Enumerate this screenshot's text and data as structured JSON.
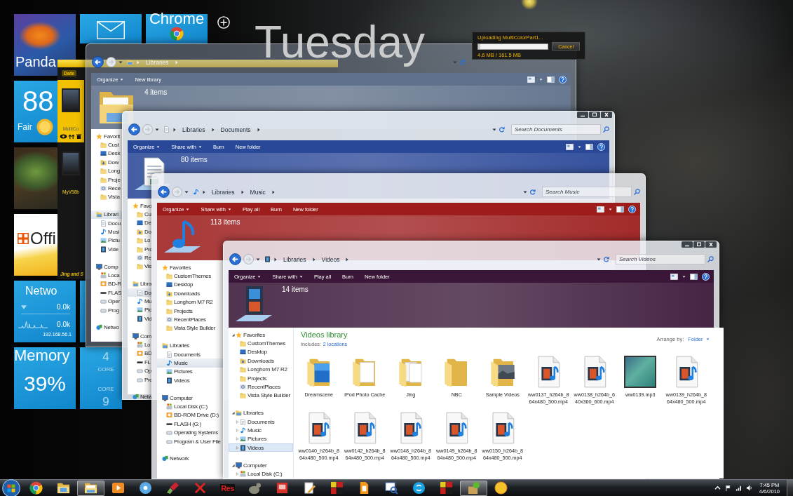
{
  "tiles": [
    {
      "kind": "photo",
      "label": "Panda"
    },
    {
      "kind": "mail"
    },
    {
      "kind": "browser",
      "label": "Chrome"
    },
    {
      "kind": "weather",
      "temperature": "88",
      "condition": "Fair"
    },
    {
      "kind": "photo"
    },
    {
      "kind": "office",
      "label": "Offi"
    },
    {
      "kind": "network",
      "label": "Netwo",
      "download": "0.0k",
      "upload": "0.0k",
      "address": "192.168.56.1"
    },
    {
      "kind": "blank"
    },
    {
      "kind": "memory",
      "label": "Memory",
      "reading": "39%"
    },
    {
      "kind": "cpu",
      "cores": [
        {
          "value": "4",
          "label": "CORE"
        },
        {
          "label": "CORE",
          "value": "9"
        }
      ]
    }
  ],
  "day_label": "Tuesday",
  "upload_dialog": {
    "title": "Uploading MultiColorPart1...",
    "level": 0.03,
    "progress": "4.6 MB / 161.5 MB",
    "button": "Cancel"
  },
  "capture_window": {
    "tab": "Date",
    "items": [
      {
        "label": "MultiCo",
        "selected": true
      },
      {
        "label": "MyV58b",
        "selected": false
      }
    ],
    "footer": "Jing and S"
  },
  "windows": [
    {
      "kind": "libraries",
      "color": "#5f708a",
      "caption_buttons": false,
      "breadcrumb": [
        "Libraries"
      ],
      "toolbar": [
        {
          "label": "Organize",
          "menu": true
        },
        {
          "label": "New library",
          "menu": false
        }
      ],
      "item_count": "4 items",
      "nav": [
        {
          "kind": "favorites",
          "label": "Favorit",
          "selected": false,
          "children": [
            {
              "kind": "folder",
              "label": "Cust",
              "selected": false
            },
            {
              "kind": "desktop",
              "label": "Desk",
              "selected": false
            },
            {
              "kind": "downloads",
              "label": "Dow",
              "selected": false
            },
            {
              "kind": "folder",
              "label": "Long",
              "selected": false
            },
            {
              "kind": "folder",
              "label": "Proje",
              "selected": false
            },
            {
              "kind": "recent",
              "label": "Rece",
              "selected": false
            },
            {
              "kind": "folder",
              "label": "Vista",
              "selected": false
            }
          ]
        },
        {
          "kind": "libraries",
          "label": "Librari",
          "selected": true,
          "children": [
            {
              "kind": "documents",
              "label": "Docu",
              "selected": false
            },
            {
              "kind": "music",
              "label": "Musi",
              "selected": false
            },
            {
              "kind": "pictures",
              "label": "Pictu",
              "selected": false
            },
            {
              "kind": "videos",
              "label": "Vide",
              "selected": false
            }
          ]
        },
        {
          "kind": "computer",
          "label": "Comp",
          "selected": false,
          "children": [
            {
              "kind": "disk",
              "label": "Loca",
              "selected": false
            },
            {
              "kind": "optical",
              "label": "BD-R",
              "selected": false
            },
            {
              "kind": "flash",
              "label": "FLAS",
              "selected": false
            },
            {
              "kind": "drive",
              "label": "Oper",
              "selected": false
            },
            {
              "kind": "drive",
              "label": "Prog",
              "selected": false
            }
          ]
        },
        {
          "kind": "network",
          "label": "Netwo",
          "selected": false
        }
      ]
    },
    {
      "kind": "documents",
      "color": "#2a4898",
      "caption_buttons": true,
      "breadcrumb": [
        "Libraries",
        "Documents"
      ],
      "search": {
        "placeholder": "Search Documents"
      },
      "toolbar": [
        {
          "label": "Organize",
          "menu": true
        },
        {
          "label": "Share with",
          "menu": true
        },
        {
          "label": "Burn",
          "menu": false
        },
        {
          "label": "New folder",
          "menu": false
        }
      ],
      "item_count": "80 items",
      "nav": [
        {
          "kind": "favorites",
          "label": "Favo",
          "selected": false,
          "children": [
            {
              "kind": "folder",
              "label": "Cu",
              "selected": false
            },
            {
              "kind": "desktop",
              "label": "De",
              "selected": false
            },
            {
              "kind": "downloads",
              "label": "Do",
              "selected": false
            },
            {
              "kind": "folder",
              "label": "Lo",
              "selected": false
            },
            {
              "kind": "folder",
              "label": "Pro",
              "selected": false
            },
            {
              "kind": "recent",
              "label": "Re",
              "selected": false
            },
            {
              "kind": "folder",
              "label": "Vis",
              "selected": false
            }
          ]
        },
        {
          "kind": "libraries",
          "label": "Libra",
          "selected": false,
          "children": [
            {
              "kind": "documents",
              "label": "Do",
              "selected": true
            },
            {
              "kind": "music",
              "label": "Mu",
              "selected": false
            },
            {
              "kind": "pictures",
              "label": "Pic",
              "selected": false
            },
            {
              "kind": "videos",
              "label": "Vid",
              "selected": false
            }
          ]
        },
        {
          "kind": "computer",
          "label": "Com",
          "selected": false,
          "children": [
            {
              "kind": "disk",
              "label": "Lo",
              "selected": false
            },
            {
              "kind": "optical",
              "label": "BD",
              "selected": false
            },
            {
              "kind": "flash",
              "label": "FL",
              "selected": false
            },
            {
              "kind": "drive",
              "label": "Op",
              "selected": false
            },
            {
              "kind": "drive",
              "label": "Pro",
              "selected": false
            }
          ]
        },
        {
          "kind": "network",
          "label": "Netw",
          "selected": false
        }
      ]
    },
    {
      "kind": "music",
      "color": "#9d1d1d",
      "caption_buttons": false,
      "breadcrumb": [
        "Libraries",
        "Music"
      ],
      "search": {
        "placeholder": "Search Music"
      },
      "toolbar": [
        {
          "label": "Organize",
          "menu": true
        },
        {
          "label": "Share with",
          "menu": true
        },
        {
          "label": "Play all",
          "menu": false
        },
        {
          "label": "Burn",
          "menu": false
        },
        {
          "label": "New folder",
          "menu": false
        }
      ],
      "item_count": "113 items",
      "nav": [
        {
          "kind": "favorites",
          "label": "Favorites",
          "selected": false,
          "children": [
            {
              "kind": "folder",
              "label": "CustomThemes",
              "selected": false
            },
            {
              "kind": "desktop",
              "label": "Desktop",
              "selected": false
            },
            {
              "kind": "downloads",
              "label": "Downloads",
              "selected": false
            },
            {
              "kind": "folder",
              "label": "Longhorn M7 R2",
              "selected": false
            },
            {
              "kind": "folder",
              "label": "Projects",
              "selected": false
            },
            {
              "kind": "recent",
              "label": "RecentPlaces",
              "selected": false
            },
            {
              "kind": "folder",
              "label": "Vista Style Builder",
              "selected": false
            }
          ]
        },
        {
          "kind": "libraries",
          "label": "Libraries",
          "selected": false,
          "children": [
            {
              "kind": "documents",
              "label": "Documents",
              "selected": false
            },
            {
              "kind": "music",
              "label": "Music",
              "selected": true
            },
            {
              "kind": "pictures",
              "label": "Pictures",
              "selected": false
            },
            {
              "kind": "videos",
              "label": "Videos",
              "selected": false
            }
          ]
        },
        {
          "kind": "computer",
          "label": "Computer",
          "selected": false,
          "children": [
            {
              "kind": "disk",
              "label": "Local Disk (C:)",
              "selected": false
            },
            {
              "kind": "optical",
              "label": "BD-ROM Drive (D:)",
              "selected": false
            },
            {
              "kind": "flash",
              "label": "FLASH (G:)",
              "selected": false
            },
            {
              "kind": "drive",
              "label": "Operating Systems",
              "selected": false
            },
            {
              "kind": "drive",
              "label": "Program & User File",
              "selected": false
            }
          ]
        },
        {
          "kind": "network",
          "label": "Network",
          "selected": false
        }
      ]
    },
    {
      "kind": "videos",
      "color": "#3a1738",
      "caption_buttons": true,
      "breadcrumb": [
        "Libraries",
        "Videos"
      ],
      "search": {
        "placeholder": "Search Videos"
      },
      "toolbar": [
        {
          "label": "Organize",
          "menu": true
        },
        {
          "label": "Share with",
          "menu": true
        },
        {
          "label": "Play all",
          "menu": false
        },
        {
          "label": "Burn",
          "menu": false
        },
        {
          "label": "New folder",
          "menu": false
        }
      ],
      "item_count": "14 items",
      "nav": [
        {
          "kind": "favorites",
          "label": "Favorites",
          "selected": false,
          "expanded": true,
          "children": [
            {
              "kind": "folder",
              "label": "CustomThemes",
              "selected": false
            },
            {
              "kind": "desktop",
              "label": "Desktop",
              "selected": false
            },
            {
              "kind": "downloads",
              "label": "Downloads",
              "selected": false
            },
            {
              "kind": "folder",
              "label": "Longhorn M7 R2",
              "selected": false
            },
            {
              "kind": "folder",
              "label": "Projects",
              "selected": false
            },
            {
              "kind": "recent",
              "label": "RecentPlaces",
              "selected": false
            },
            {
              "kind": "folder",
              "label": "Vista Style Builder",
              "selected": false
            }
          ]
        },
        {
          "kind": "libraries",
          "label": "Libraries",
          "selected": false,
          "expanded": true,
          "children": [
            {
              "kind": "documents",
              "label": "Documents",
              "selected": false,
              "expanded": false
            },
            {
              "kind": "music",
              "label": "Music",
              "selected": false,
              "expanded": false
            },
            {
              "kind": "pictures",
              "label": "Pictures",
              "selected": false,
              "expanded": false
            },
            {
              "kind": "videos",
              "label": "Videos",
              "selected": true,
              "expanded": false
            }
          ]
        },
        {
          "kind": "computer",
          "label": "Computer",
          "selected": false,
          "expanded": true,
          "children": [
            {
              "kind": "disk",
              "label": "Local Disk (C:)",
              "selected": false,
              "expanded": false
            }
          ]
        }
      ],
      "content": {
        "title": "Videos library",
        "includes": "Includes:",
        "locations": "2 locations",
        "arrange_label": "Arrange by:",
        "arrange_value": "Folder",
        "items": [
          {
            "kind": "imagefolder",
            "label": "Dreamscene"
          },
          {
            "kind": "pagefolder",
            "label": "iPod Photo Cache"
          },
          {
            "kind": "pagesfolder",
            "label": "Jing"
          },
          {
            "kind": "folder",
            "label": "NBC"
          },
          {
            "kind": "photofolder",
            "label": "Sample Videos"
          },
          {
            "kind": "media",
            "label": "ww0137_h264b_864x480_500.mp4"
          },
          {
            "kind": "media",
            "label": "ww0138_h264b_640x360_600.mp4"
          },
          {
            "kind": "album",
            "label": "ww0139.mp3"
          },
          {
            "kind": "media",
            "label": "ww0139_h264b_864x480_500.mp4"
          },
          {
            "kind": "media",
            "label": "ww0140_h264b_864x480_500.mp4"
          },
          {
            "kind": "media",
            "label": "ww0142_h264b_864x480_500.mp4"
          },
          {
            "kind": "media",
            "label": "ww0148_h264b_864x480_500.mp4"
          },
          {
            "kind": "media",
            "label": "ww0149_h264b_864x480_500.mp4"
          },
          {
            "kind": "media",
            "label": "ww0150_h264b_864x480_500.mp4"
          }
        ]
      }
    }
  ],
  "taskbar": {
    "items": [
      {
        "kind": "wheel",
        "active": false
      },
      {
        "kind": "explorer",
        "active": false
      },
      {
        "kind": "library",
        "active": true
      },
      {
        "kind": "player",
        "active": false
      },
      {
        "kind": "disc",
        "active": false
      },
      {
        "kind": "brush",
        "active": false
      },
      {
        "kind": "cross",
        "active": false
      },
      {
        "kind": "text",
        "label": "Res",
        "active": false
      },
      {
        "kind": "animal",
        "active": false
      },
      {
        "kind": "slide",
        "active": false
      },
      {
        "kind": "pencil",
        "active": false
      },
      {
        "kind": "cubes",
        "active": false
      },
      {
        "kind": "page",
        "active": false
      },
      {
        "kind": "magnifier",
        "active": false
      },
      {
        "kind": "bubble",
        "active": false
      },
      {
        "kind": "cubes",
        "active": false
      },
      {
        "kind": "package",
        "active": true
      },
      {
        "kind": "sun",
        "active": false
      }
    ],
    "clock": {
      "time": "7:45 PM",
      "date": "4/6/2010"
    }
  }
}
